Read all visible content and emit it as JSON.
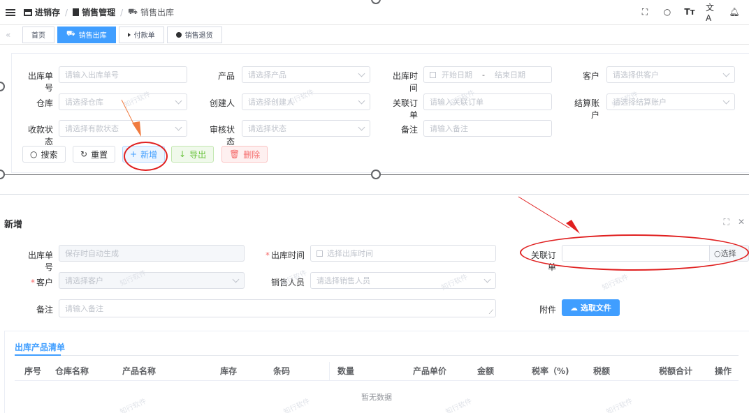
{
  "breadcrumb": {
    "items": [
      "进销存",
      "销售管理",
      "销售出库"
    ]
  },
  "tabs": [
    {
      "label": "首页",
      "active": false
    },
    {
      "label": "销售出库",
      "active": true
    },
    {
      "label": "付款单",
      "active": false
    },
    {
      "label": "销售退货",
      "active": false
    }
  ],
  "search": {
    "outbound_no": {
      "label": "出库单号",
      "placeholder": "请输入出库单号"
    },
    "product": {
      "label": "产品",
      "placeholder": "请选择产品"
    },
    "outbound_time": {
      "label": "出库时间",
      "start": "开始日期",
      "sep": "-",
      "end": "结束日期"
    },
    "customer": {
      "label": "客户",
      "placeholder": "请选择供客户"
    },
    "warehouse": {
      "label": "仓库",
      "placeholder": "请选择仓库"
    },
    "creator": {
      "label": "创建人",
      "placeholder": "请选择创建人"
    },
    "linked_order": {
      "label": "关联订单",
      "placeholder": "请输入关联订单"
    },
    "settle_account": {
      "label": "结算账户",
      "placeholder": "请选择结算账户"
    },
    "receipt_status": {
      "label": "收款状态",
      "placeholder": "请选择有款状态"
    },
    "audit_status": {
      "label": "审核状态",
      "placeholder": "请选择状态"
    },
    "remark": {
      "label": "备注",
      "placeholder": "请输入备注"
    }
  },
  "actions": {
    "search": "搜索",
    "reset": "重置",
    "add": "新增",
    "export": "导出",
    "delete": "删除"
  },
  "dialog": {
    "title": "新增",
    "outbound_no": {
      "label": "出库单号",
      "value": "保存时自动生成"
    },
    "outbound_time": {
      "label": "出库时间",
      "placeholder": "选择出库时间"
    },
    "linked_order": {
      "label": "关联订单",
      "value": "",
      "button": "选择"
    },
    "customer": {
      "label": "客户",
      "placeholder": "请选择客户"
    },
    "salesperson": {
      "label": "销售人员",
      "placeholder": "请选择销售人员"
    },
    "remark": {
      "label": "备注",
      "placeholder": "请输入备注"
    },
    "attachment": {
      "label": "附件",
      "button": "选取文件"
    }
  },
  "product_list": {
    "tab": "出库产品清单",
    "columns": [
      "序号",
      "仓库名称",
      "产品名称",
      "库存",
      "条码",
      "数量",
      "产品单价",
      "金额",
      "税率（%)",
      "税额",
      "税额合计",
      "操作"
    ],
    "empty": "暂无数据"
  },
  "watermark": "知行软件",
  "colors": {
    "primary": "#409eff",
    "success": "#67c23a",
    "danger": "#f56c6c",
    "annotation_red": "#e02020",
    "annotation_orange": "#f07b3f"
  }
}
